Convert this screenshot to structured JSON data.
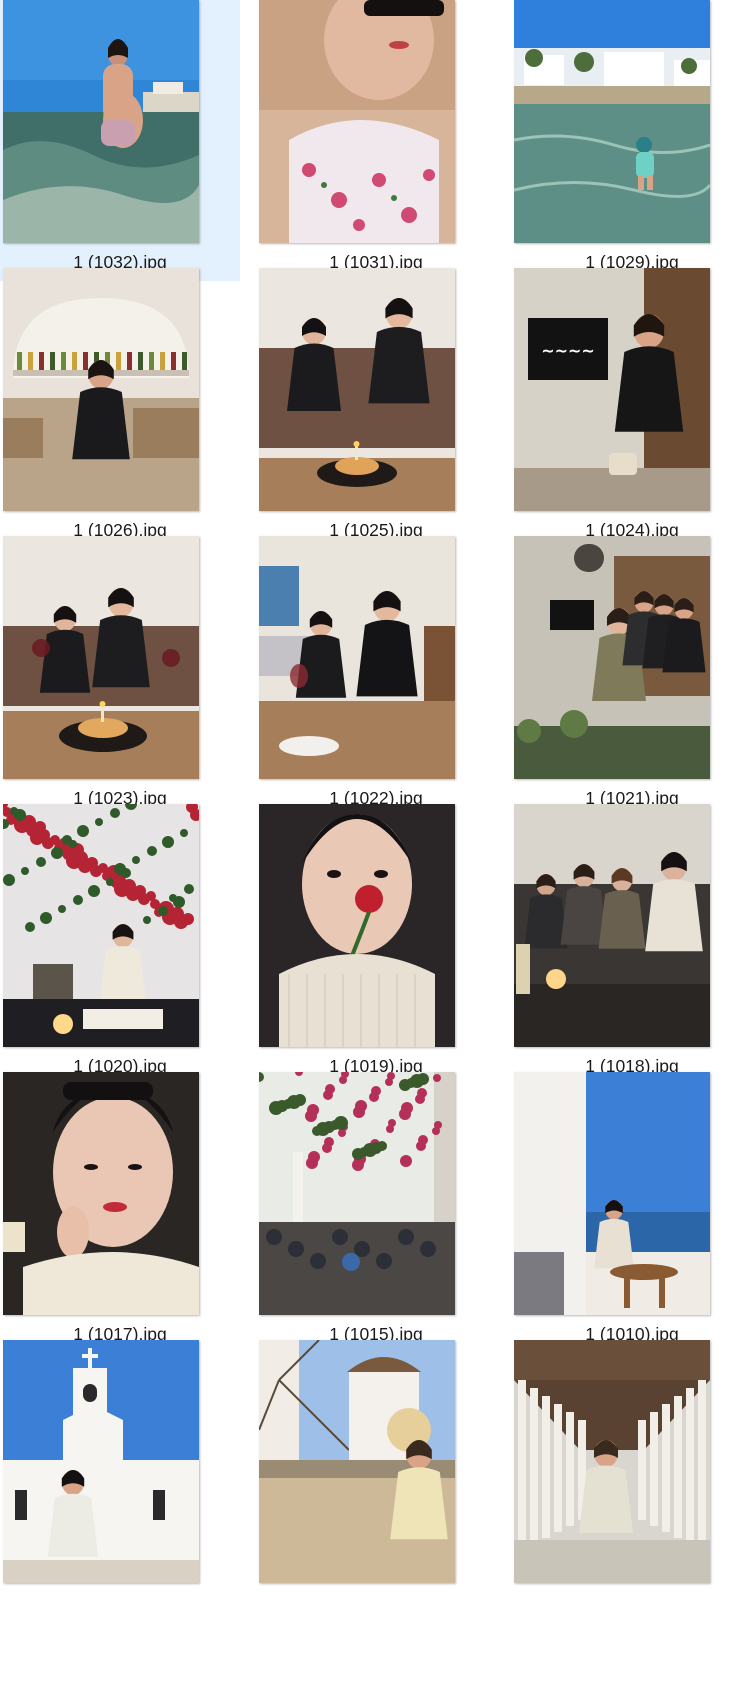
{
  "files": [
    {
      "name": "1 (1032).jpg",
      "selected": true,
      "scene": "sea-back"
    },
    {
      "name": "1 (1031).jpg",
      "selected": false,
      "scene": "closeup-floral"
    },
    {
      "name": "1 (1029).jpg",
      "selected": false,
      "scene": "beach-child"
    },
    {
      "name": "1 (1026).jpg",
      "selected": false,
      "scene": "bar-black-dress"
    },
    {
      "name": "1 (1025).jpg",
      "selected": false,
      "scene": "birthday-cake-two"
    },
    {
      "name": "1 (1024).jpg",
      "selected": false,
      "scene": "restaurant-sign"
    },
    {
      "name": "1 (1023).jpg",
      "selected": false,
      "scene": "birthday-toast"
    },
    {
      "name": "1 (1022).jpg",
      "selected": false,
      "scene": "dinner-table"
    },
    {
      "name": "1 (1021).jpg",
      "selected": false,
      "scene": "group-sign"
    },
    {
      "name": "1 (1020).jpg",
      "selected": false,
      "scene": "flowers-wall"
    },
    {
      "name": "1 (1019).jpg",
      "selected": false,
      "scene": "rose-selfie"
    },
    {
      "name": "1 (1018).jpg",
      "selected": false,
      "scene": "night-group"
    },
    {
      "name": "1 (1017).jpg",
      "selected": false,
      "scene": "hand-cheek"
    },
    {
      "name": "1 (1015).jpg",
      "selected": false,
      "scene": "alley-bougainvillea"
    },
    {
      "name": "1 (1010).jpg",
      "selected": false,
      "scene": "sea-terrace"
    },
    {
      "name": "",
      "selected": false,
      "scene": "white-chapel"
    },
    {
      "name": "",
      "selected": false,
      "scene": "windmill-hat"
    },
    {
      "name": "",
      "selected": false,
      "scene": "colonnade"
    }
  ]
}
